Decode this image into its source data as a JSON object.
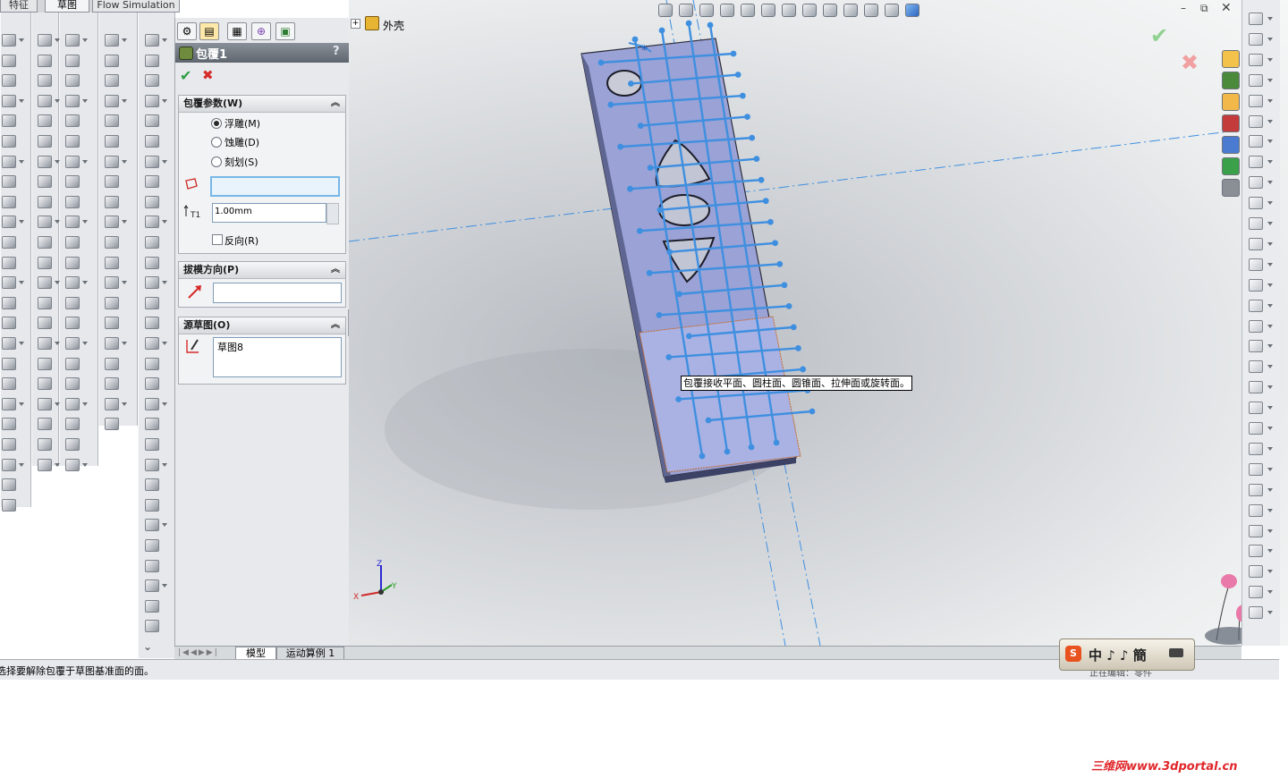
{
  "tabs": [
    "特征",
    "草图",
    "Flow Simulation"
  ],
  "feature_tree": {
    "root_label": "外壳"
  },
  "property_manager": {
    "title": "包覆1",
    "help_glyph": "?",
    "ok_glyph": "✔",
    "cancel_glyph": "✖",
    "wrap_params": {
      "header": "包覆参数(W)",
      "options": [
        {
          "label": "浮雕(M)",
          "selected": true
        },
        {
          "label": "蚀雕(D)",
          "selected": false
        },
        {
          "label": "刻划(S)",
          "selected": false
        }
      ],
      "face_value": "",
      "thickness_value": "1.00mm",
      "reverse_label": "反向(R)"
    },
    "draft_direction": {
      "header": "拔模方向(P)",
      "value": ""
    },
    "source_sketch": {
      "header": "源草图(O)",
      "value": "草图8"
    }
  },
  "viewport": {
    "tooltip": "包覆接收平面、圆柱面、圆锥面、拉伸面或旋转面。",
    "triad": {
      "x": "X",
      "y": "Y",
      "z": "Z"
    }
  },
  "bottom_tabs": [
    "模型",
    "运动算例 1"
  ],
  "status": {
    "message": "选择要解除包覆于草图基准面的面。",
    "right_text": "正在编辑：零件"
  },
  "ime": {
    "label": "中 ♪ ♪ 簡"
  },
  "watermark": "三维网www.3dportal.cn",
  "colors": {
    "accent_blue": "#3f8fe0",
    "accept_green": "#2ea043",
    "cancel_red": "#d62b2b",
    "watermark_red": "#e0262a"
  }
}
